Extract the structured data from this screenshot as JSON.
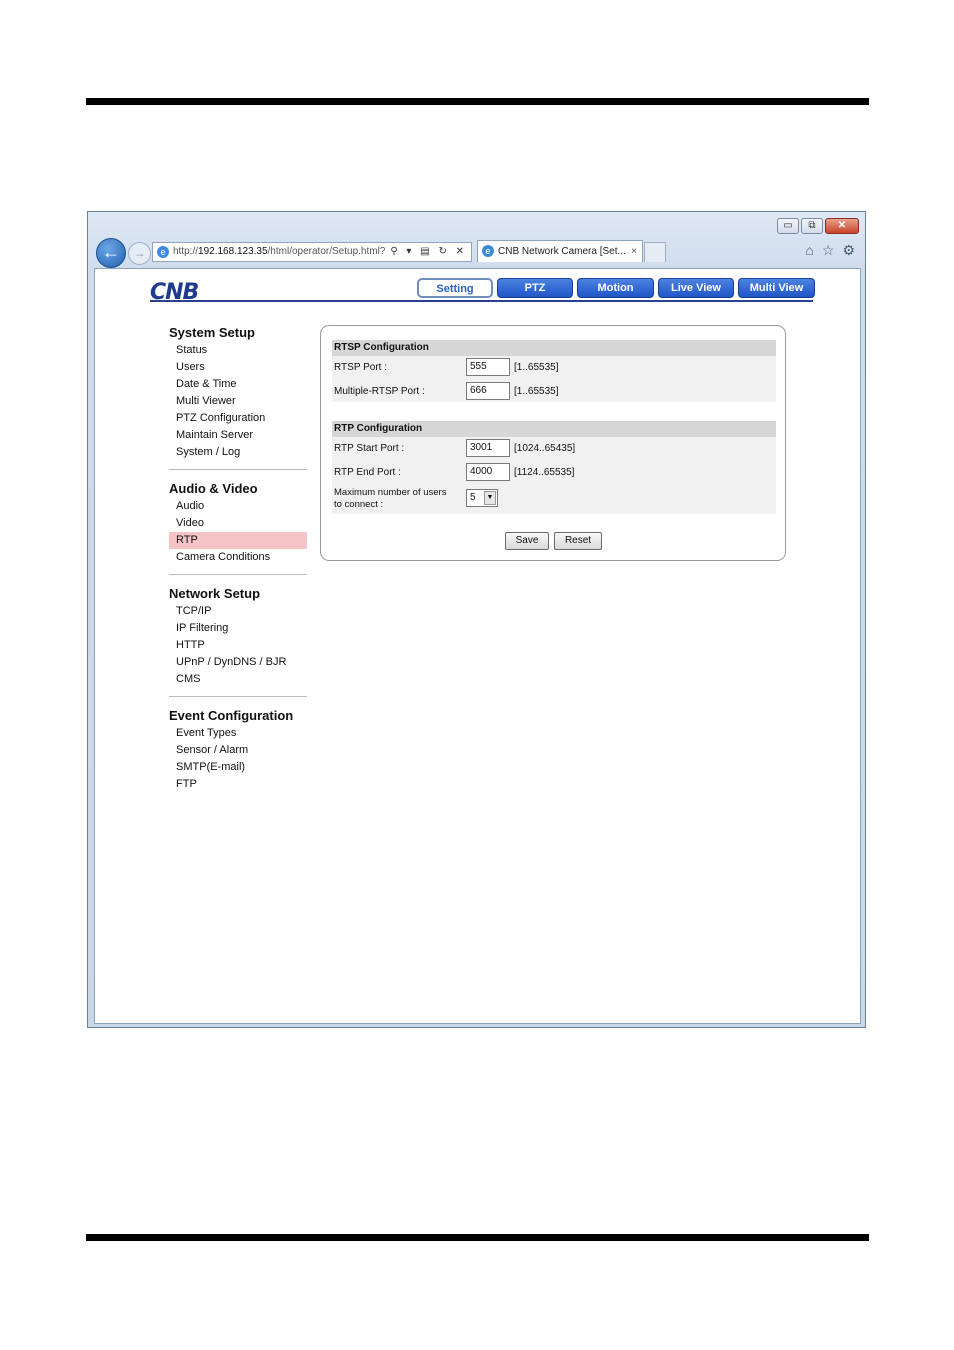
{
  "browser": {
    "address_prefix": "http://",
    "address_host": "192.168.123.35",
    "address_path": "/html/operator/Setup.html?",
    "address_tools": "⚲ ▾ ▤ ↻ ✕",
    "tab_title": "CNB Network Camera [Set...",
    "tab_close": "×",
    "window_buttons": {
      "minimize": "▭",
      "restore": "⧉",
      "close": "✕"
    },
    "toolbar_icons": [
      "home-icon",
      "star-icon",
      "gear-icon"
    ]
  },
  "header": {
    "logo_text": "CNB",
    "tabs": [
      {
        "label": "Setting",
        "active": true
      },
      {
        "label": "PTZ",
        "active": false
      },
      {
        "label": "Motion",
        "active": false
      },
      {
        "label": "Live View",
        "active": false
      },
      {
        "label": "Multi View",
        "active": false
      }
    ]
  },
  "sidebar": {
    "sections": [
      {
        "title": "System Setup",
        "items": [
          "Status",
          "Users",
          "Date & Time",
          "Multi Viewer",
          "PTZ Configuration",
          "Maintain Server",
          "System / Log"
        ]
      },
      {
        "title": "Audio & Video",
        "items": [
          "Audio",
          "Video",
          "RTP",
          "Camera Conditions"
        ],
        "active": "RTP"
      },
      {
        "title": "Network Setup",
        "items": [
          "TCP/IP",
          "IP Filtering",
          "HTTP",
          "UPnP / DynDNS / BJR",
          "CMS"
        ]
      },
      {
        "title": "Event Configuration",
        "items": [
          "Event Types",
          "Sensor / Alarm",
          "SMTP(E-mail)",
          "FTP"
        ]
      }
    ]
  },
  "rtsp": {
    "heading": "RTSP Configuration",
    "rtsp_port": {
      "label": "RTSP Port :",
      "value": "555",
      "range": "[1..65535]"
    },
    "multi_rtsp_port": {
      "label": "Multiple-RTSP Port :",
      "value": "666",
      "range": "[1..65535]"
    }
  },
  "rtp": {
    "heading": "RTP Configuration",
    "start_port": {
      "label": "RTP Start Port :",
      "value": "3001",
      "range": "[1024..65435]"
    },
    "end_port": {
      "label": "RTP End Port :",
      "value": "4000",
      "range": "[1124..65535]"
    },
    "max_users": {
      "label_line1": "Maximum number of users",
      "label_line2": "to connect :",
      "value": "5"
    }
  },
  "buttons": {
    "save": "Save",
    "reset": "Reset"
  }
}
